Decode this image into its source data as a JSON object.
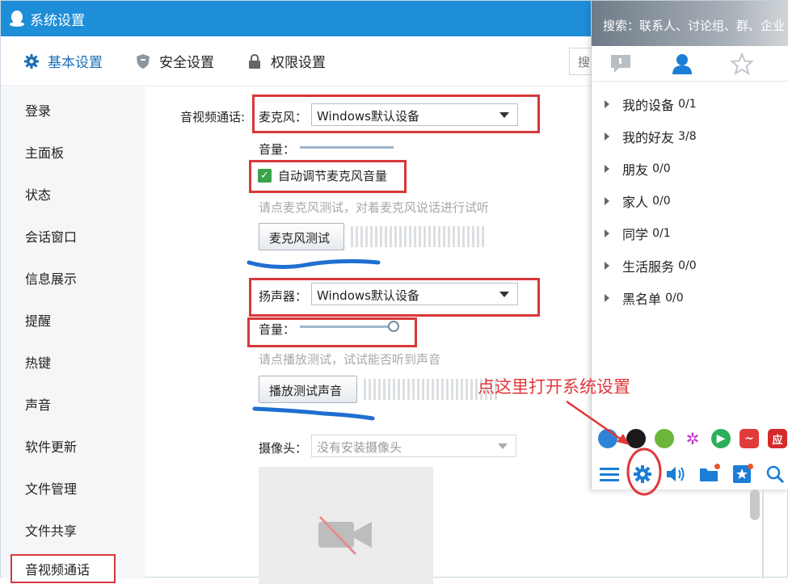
{
  "window": {
    "title": "系统设置"
  },
  "tabs": [
    {
      "label": "基本设置",
      "icon": "gear-icon"
    },
    {
      "label": "安全设置",
      "icon": "shield-icon"
    },
    {
      "label": "权限设置",
      "icon": "lock-icon"
    }
  ],
  "top_search": {
    "value": "搜"
  },
  "sidebar": {
    "items": [
      {
        "label": "登录"
      },
      {
        "label": "主面板"
      },
      {
        "label": "状态"
      },
      {
        "label": "会话窗口"
      },
      {
        "label": "信息展示"
      },
      {
        "label": "提醒"
      },
      {
        "label": "热键"
      },
      {
        "label": "声音"
      },
      {
        "label": "软件更新"
      },
      {
        "label": "文件管理"
      },
      {
        "label": "文件共享"
      },
      {
        "label": "音视频通话"
      }
    ]
  },
  "av": {
    "section_label": "音视频通话:",
    "mic_label": "麦克风：",
    "mic_device": "Windows默认设备",
    "volume_label": "音量：",
    "mic_volume": 0,
    "auto_adjust_label": "自动调节麦克风音量",
    "auto_adjust_checked": true,
    "mic_hint": "请点麦克风测试，对着麦克风说话进行试听",
    "mic_test_button": "麦克风测试",
    "speaker_label": "扬声器：",
    "speaker_device": "Windows默认设备",
    "speaker_volume_label": "音量：",
    "speaker_volume": 100,
    "speaker_hint": "请点播放测试，试试能否听到声音",
    "speaker_test_button": "播放测试声音",
    "camera_label": "摄像头：",
    "camera_value": "没有安装摄像头"
  },
  "panel": {
    "search_placeholder": "搜索：联系人、讨论组、群、企业",
    "groups": [
      {
        "name": "我的设备",
        "count": "0/1"
      },
      {
        "name": "我的好友",
        "count": "3/8"
      },
      {
        "name": "朋友",
        "count": "0/0"
      },
      {
        "name": "家人",
        "count": "0/0"
      },
      {
        "name": "同学",
        "count": "0/1"
      },
      {
        "name": "生活服务",
        "count": "0/0"
      },
      {
        "name": "黑名单",
        "count": "0/0"
      }
    ],
    "app_icons": [
      "browser-icon",
      "qq-penguin-icon",
      "wallet-icon",
      "pinwheel-icon",
      "video-play-icon",
      "stock-icon",
      "app-store-icon"
    ],
    "app_store_glyph": "应"
  },
  "annotation": {
    "text": "点这里打开系统设置"
  },
  "colors": {
    "titlebar": "#1e8ed8",
    "annotation_red": "#d7383b",
    "accent_blue": "#1b6fb5",
    "check_green": "#3aa34a"
  }
}
